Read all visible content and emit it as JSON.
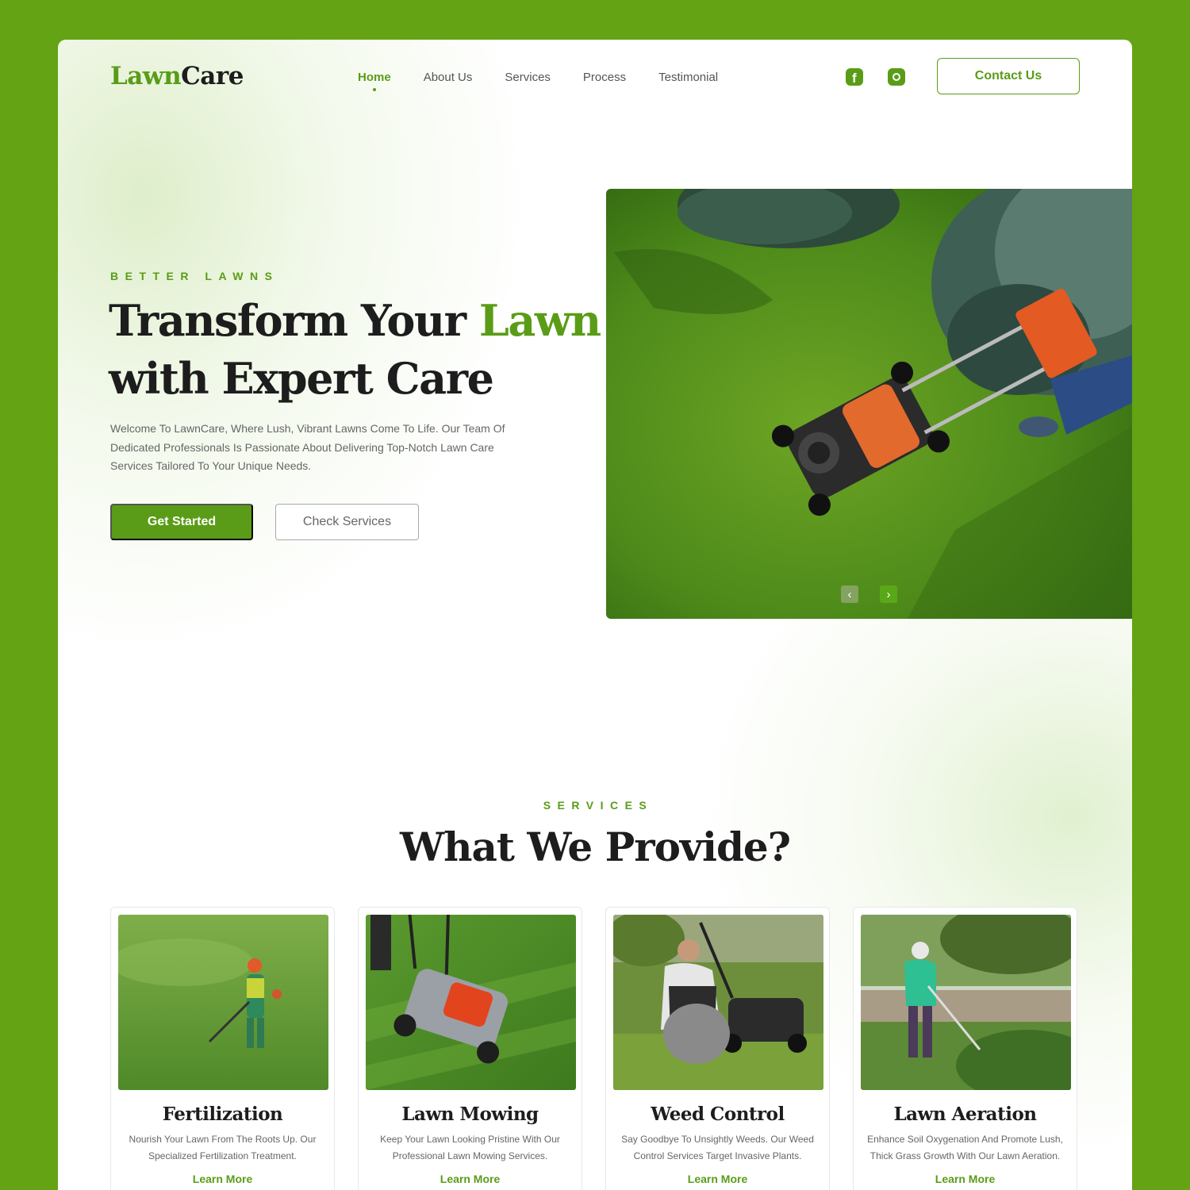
{
  "logo": {
    "part1": "Lawn",
    "part2": "Care"
  },
  "nav": {
    "items": [
      {
        "label": "Home",
        "active": true
      },
      {
        "label": "About Us",
        "active": false
      },
      {
        "label": "Services",
        "active": false
      },
      {
        "label": "Process",
        "active": false
      },
      {
        "label": "Testimonial",
        "active": false
      }
    ]
  },
  "social": {
    "icons": [
      "facebook-icon",
      "instagram-icon"
    ],
    "facebook_glyph": "f"
  },
  "contact_button": "Contact Us",
  "hero": {
    "eyebrow": "BETTER LAWNS",
    "title_part1": "Transform Your ",
    "title_highlight": "Lawn",
    "title_part2": "with Expert Care",
    "description": "Welcome To LawnCare, Where Lush, Vibrant Lawns Come To Life. Our Team Of Dedicated Professionals Is Passionate About Delivering Top-Notch Lawn Care Services Tailored To Your Unique Needs.",
    "primary_button": "Get Started",
    "secondary_button": "Check Services",
    "carousel_prev": "‹",
    "carousel_next": "›"
  },
  "services": {
    "eyebrow": "SERVICES",
    "title": "What We Provide?",
    "cards": [
      {
        "title": "Fertilization",
        "description": "Nourish Your Lawn From The Roots Up. Our Specialized Fertilization Treatment.",
        "link": "Learn More"
      },
      {
        "title": "Lawn Mowing",
        "description": "Keep Your Lawn Looking Pristine With Our Professional Lawn Mowing Services.",
        "link": "Learn More"
      },
      {
        "title": "Weed Control",
        "description": "Say Goodbye To Unsightly Weeds. Our Weed Control Services Target Invasive Plants.",
        "link": "Learn More"
      },
      {
        "title": "Lawn Aeration",
        "description": "Enhance Soil Oxygenation And Promote Lush, Thick Grass Growth With Our Lawn Aeration.",
        "link": "Learn More"
      }
    ]
  },
  "colors": {
    "brand_green": "#5a9c17",
    "frame_green": "#63a314",
    "heading": "#1d1d1d",
    "body_text": "#666666"
  }
}
